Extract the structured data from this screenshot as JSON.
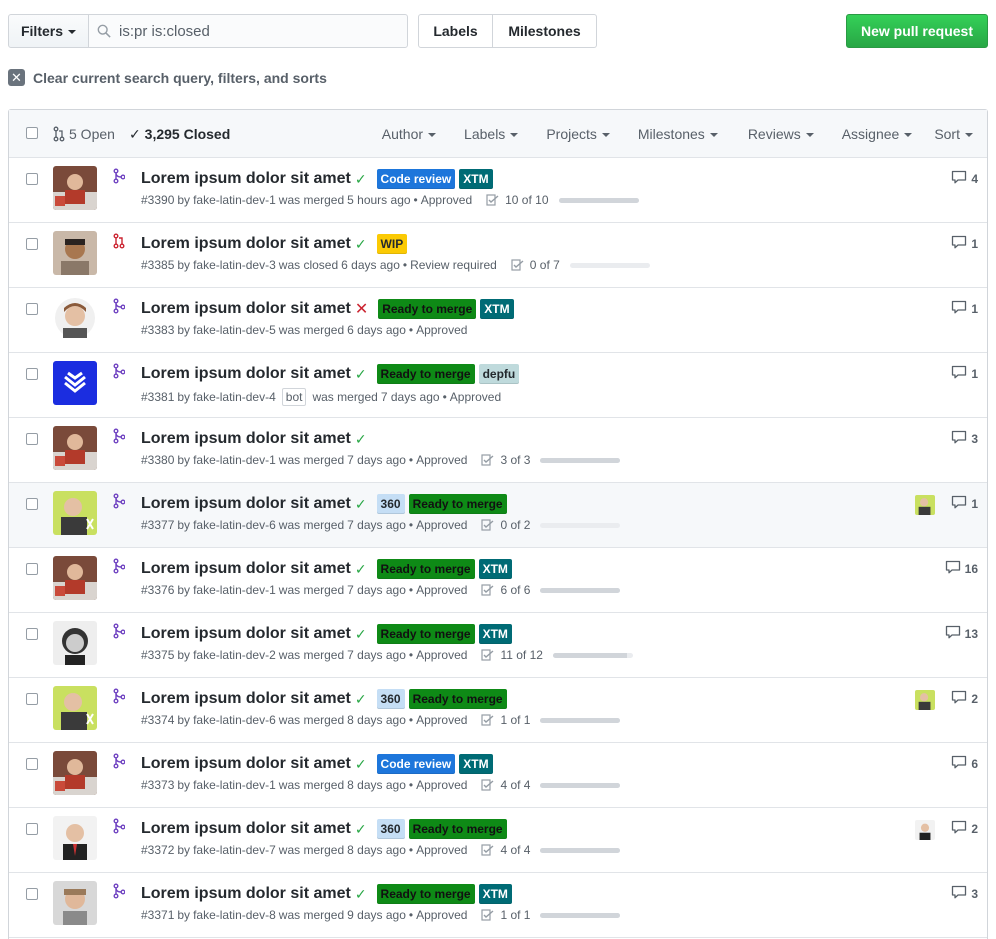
{
  "toolbar": {
    "filters_label": "Filters",
    "search_value": "is:pr is:closed",
    "labels_label": "Labels",
    "milestones_label": "Milestones",
    "new_pr_label": "New pull request"
  },
  "clear_query_label": "Clear current search query, filters, and sorts",
  "header": {
    "open_count": "5 Open",
    "closed_count": "3,295 Closed",
    "menus": [
      "Author",
      "Labels",
      "Projects",
      "Milestones",
      "Reviews",
      "Assignee",
      "Sort"
    ]
  },
  "colors": {
    "merged": "#6f42c1",
    "closed": "#cb2431",
    "success": "#28a745",
    "primary_button": "#28a745"
  },
  "pull_requests": [
    {
      "title": "Lorem ipsum dolor sit amet",
      "status": "success",
      "state": "merged",
      "labels": [
        {
          "text": "Code review",
          "kind": "code"
        },
        {
          "text": "XTM",
          "kind": "xtm"
        }
      ],
      "number": "#3390",
      "author": "fake-latin-dev-1",
      "bot": "",
      "action": "was merged",
      "time": "5 hours ago",
      "review": "Approved",
      "tasks": "10 of 10",
      "task_fraction": 1.0,
      "comments": "4",
      "assignee": false,
      "avatar": "a1"
    },
    {
      "title": "Lorem ipsum dolor sit amet",
      "status": "success",
      "state": "closed",
      "labels": [
        {
          "text": "WIP",
          "kind": "wip"
        }
      ],
      "number": "#3385",
      "author": "fake-latin-dev-3",
      "bot": "",
      "action": "was closed",
      "time": "6 days ago",
      "review": "Review required",
      "tasks": "0 of 7",
      "task_fraction": 0.0,
      "comments": "1",
      "assignee": false,
      "avatar": "a3"
    },
    {
      "title": "Lorem ipsum dolor sit amet",
      "status": "fail",
      "state": "merged",
      "labels": [
        {
          "text": "Ready to merge",
          "kind": "ready"
        },
        {
          "text": "XTM",
          "kind": "xtm"
        }
      ],
      "number": "#3383",
      "author": "fake-latin-dev-5",
      "bot": "",
      "action": "was merged",
      "time": "6 days ago",
      "review": "Approved",
      "tasks": "",
      "task_fraction": null,
      "comments": "1",
      "assignee": false,
      "avatar": "a5"
    },
    {
      "title": "Lorem ipsum dolor sit amet",
      "status": "success",
      "state": "merged",
      "labels": [
        {
          "text": "Ready to merge",
          "kind": "ready"
        },
        {
          "text": "depfu",
          "kind": "depfu"
        }
      ],
      "number": "#3381",
      "author": "fake-latin-dev-4",
      "bot": "bot",
      "action": "was merged",
      "time": "7 days ago",
      "review": "Approved",
      "tasks": "",
      "task_fraction": null,
      "comments": "1",
      "assignee": false,
      "avatar": "a4"
    },
    {
      "title": "Lorem ipsum dolor sit amet",
      "status": "success",
      "state": "merged",
      "labels": [],
      "number": "#3380",
      "author": "fake-latin-dev-1",
      "bot": "",
      "action": "was merged",
      "time": "7 days ago",
      "review": "Approved",
      "tasks": "3 of 3",
      "task_fraction": 1.0,
      "comments": "3",
      "assignee": false,
      "avatar": "a1"
    },
    {
      "title": "Lorem ipsum dolor sit amet",
      "status": "success",
      "state": "merged",
      "labels": [
        {
          "text": "360",
          "kind": "360"
        },
        {
          "text": "Ready to merge",
          "kind": "ready"
        }
      ],
      "number": "#3377",
      "author": "fake-latin-dev-6",
      "bot": "",
      "action": "was merged",
      "time": "7 days ago",
      "review": "Approved",
      "tasks": "0 of 2",
      "task_fraction": 0.0,
      "comments": "1",
      "assignee": true,
      "avatar": "a6",
      "highlight": true
    },
    {
      "title": "Lorem ipsum dolor sit amet",
      "status": "success",
      "state": "merged",
      "labels": [
        {
          "text": "Ready to merge",
          "kind": "ready"
        },
        {
          "text": "XTM",
          "kind": "xtm"
        }
      ],
      "number": "#3376",
      "author": "fake-latin-dev-1",
      "bot": "",
      "action": "was merged",
      "time": "7 days ago",
      "review": "Approved",
      "tasks": "6 of 6",
      "task_fraction": 1.0,
      "comments": "16",
      "assignee": false,
      "avatar": "a1"
    },
    {
      "title": "Lorem ipsum dolor sit amet",
      "status": "success",
      "state": "merged",
      "labels": [
        {
          "text": "Ready to merge",
          "kind": "ready"
        },
        {
          "text": "XTM",
          "kind": "xtm"
        }
      ],
      "number": "#3375",
      "author": "fake-latin-dev-2",
      "bot": "",
      "action": "was merged",
      "time": "7 days ago",
      "review": "Approved",
      "tasks": "11 of 12",
      "task_fraction": 0.92,
      "comments": "13",
      "assignee": false,
      "avatar": "a2"
    },
    {
      "title": "Lorem ipsum dolor sit amet",
      "status": "success",
      "state": "merged",
      "labels": [
        {
          "text": "360",
          "kind": "360"
        },
        {
          "text": "Ready to merge",
          "kind": "ready"
        }
      ],
      "number": "#3374",
      "author": "fake-latin-dev-6",
      "bot": "",
      "action": "was merged",
      "time": "8 days ago",
      "review": "Approved",
      "tasks": "1 of 1",
      "task_fraction": 1.0,
      "comments": "2",
      "assignee": true,
      "avatar": "a6"
    },
    {
      "title": "Lorem ipsum dolor sit amet",
      "status": "success",
      "state": "merged",
      "labels": [
        {
          "text": "Code review",
          "kind": "code"
        },
        {
          "text": "XTM",
          "kind": "xtm"
        }
      ],
      "number": "#3373",
      "author": "fake-latin-dev-1",
      "bot": "",
      "action": "was merged",
      "time": "8 days ago",
      "review": "Approved",
      "tasks": "4 of 4",
      "task_fraction": 1.0,
      "comments": "6",
      "assignee": false,
      "avatar": "a1"
    },
    {
      "title": "Lorem ipsum dolor sit amet",
      "status": "success",
      "state": "merged",
      "labels": [
        {
          "text": "360",
          "kind": "360"
        },
        {
          "text": "Ready to merge",
          "kind": "ready"
        }
      ],
      "number": "#3372",
      "author": "fake-latin-dev-7",
      "bot": "",
      "action": "was merged",
      "time": "8 days ago",
      "review": "Approved",
      "tasks": "4 of 4",
      "task_fraction": 1.0,
      "comments": "2",
      "assignee": true,
      "avatar": "a7"
    },
    {
      "title": "Lorem ipsum dolor sit amet",
      "status": "success",
      "state": "merged",
      "labels": [
        {
          "text": "Ready to merge",
          "kind": "ready"
        },
        {
          "text": "XTM",
          "kind": "xtm"
        }
      ],
      "number": "#3371",
      "author": "fake-latin-dev-8",
      "bot": "",
      "action": "was merged",
      "time": "9 days ago",
      "review": "Approved",
      "tasks": "1 of 1",
      "task_fraction": 1.0,
      "comments": "3",
      "assignee": false,
      "avatar": "a8"
    }
  ]
}
